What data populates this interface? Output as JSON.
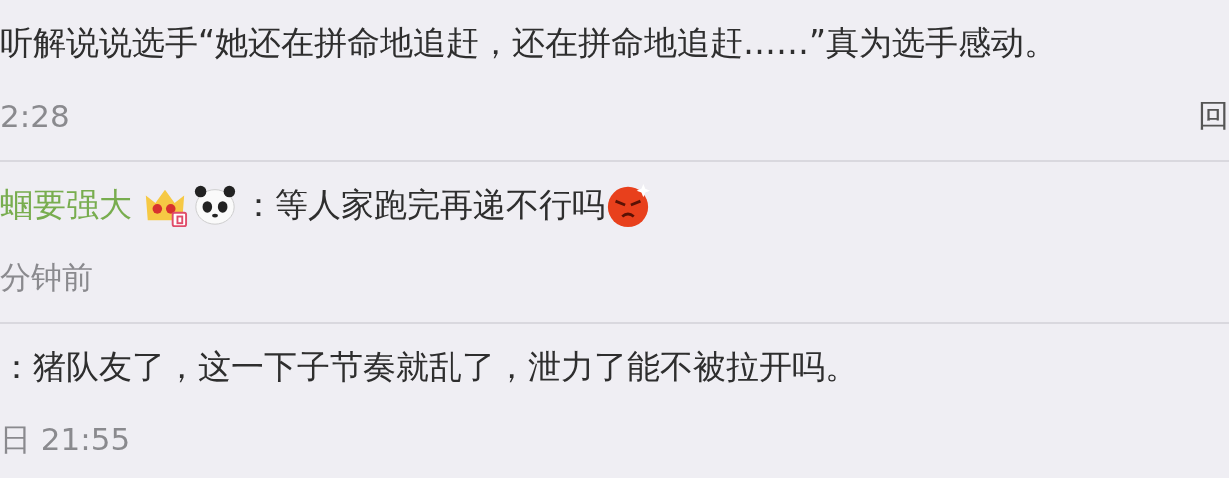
{
  "comments": [
    {
      "kind": "plain",
      "text": "听解说说选手“她还在拼命地追赶，还在拼命地追赶……”真为选手感动。",
      "time": "2:28",
      "reply": "回"
    },
    {
      "kind": "user",
      "author": "蝈要强大",
      "separator": "：",
      "text": "等人家跑完再递不行吗",
      "time": "分钟前"
    },
    {
      "kind": "plain",
      "separator": "：",
      "text": "猪队友了，这一下子节奏就乱了，泄力了能不被拉开吗。",
      "time": "日 21:55"
    }
  ]
}
